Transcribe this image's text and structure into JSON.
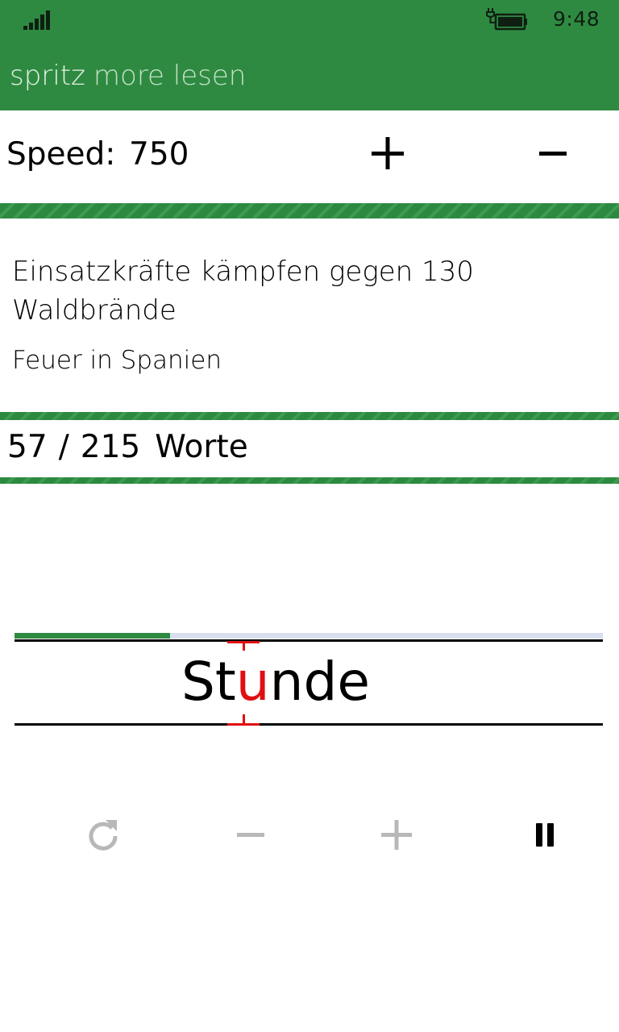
{
  "status_bar": {
    "time": "9:48"
  },
  "app": {
    "title_brand": "spritz",
    "title_rest": "more lesen",
    "accent": "#2f8a41",
    "pivot_color": "#e01010"
  },
  "speed": {
    "label": "Speed:",
    "value": "750"
  },
  "article": {
    "title": "Einsatzkräfte kämpfen gegen 130 Waldbrände",
    "subtitle": "Feuer in Spanien"
  },
  "counter": {
    "current": "57",
    "separator": "/",
    "total": "215",
    "unit": "Worte"
  },
  "reader": {
    "progress": 0.265,
    "word_prefix": "St",
    "word_pivot": "u",
    "word_suffix": "nde"
  },
  "controls": {
    "restart_icon": "restart-icon",
    "slower_icon": "minus-icon",
    "faster_icon": "plus-icon",
    "pause_icon": "pause-icon"
  }
}
